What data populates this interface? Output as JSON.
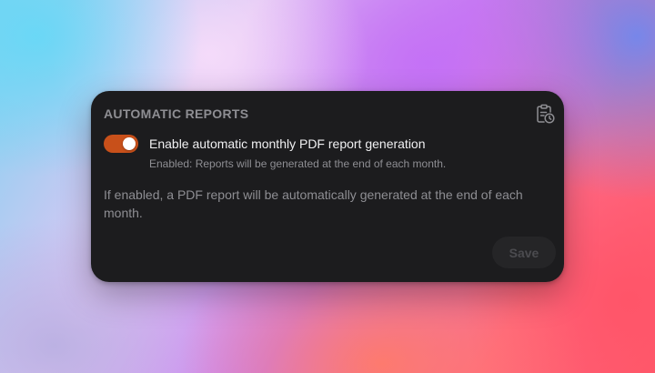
{
  "card": {
    "title": "AUTOMATIC REPORTS",
    "header_icon": "clipboard-clock-icon"
  },
  "toggle": {
    "state": "on",
    "label": "Enable automatic monthly PDF report generation",
    "status_text": "Enabled: Reports will be generated at the end of each month."
  },
  "description": "If enabled, a PDF report will be automatically generated at the end of each month.",
  "actions": {
    "save_label": "Save",
    "save_disabled": true
  },
  "colors": {
    "card_background": "#1c1c1e",
    "toggle_on": "#c8501a",
    "muted_text": "#8e8e93"
  }
}
